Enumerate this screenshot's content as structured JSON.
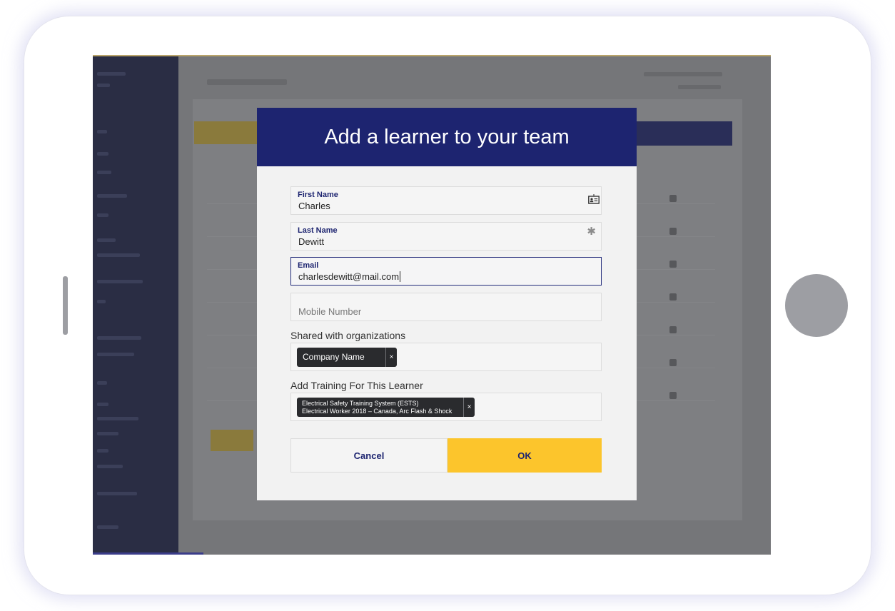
{
  "modal": {
    "title": "Add a learner to your team",
    "first_name": {
      "label": "First Name",
      "value": "Charles"
    },
    "last_name": {
      "label": "Last Name",
      "value": "Dewitt"
    },
    "email": {
      "label": "Email",
      "value": "charlesdewitt@mail.com"
    },
    "mobile": {
      "placeholder": "Mobile Number"
    },
    "organizations": {
      "label": "Shared with organizations",
      "tags": [
        "Company Name"
      ]
    },
    "training": {
      "label": "Add Training For This Learner",
      "tags": [
        {
          "line1": "Electrical Safety Training System (ESTS)",
          "line2": "Electrical Worker 2018 – Canada, Arc Flash & Shock"
        }
      ]
    },
    "required_marker": "✱",
    "remove_glyph": "×",
    "cancel_label": "Cancel",
    "ok_label": "OK"
  },
  "colors": {
    "header": "#1d2470",
    "accent": "#fcc52c",
    "overlay": "#7a7b7e"
  },
  "icons": [
    "contact-card-icon",
    "required-asterisk-icon",
    "remove-tag-icon"
  ]
}
